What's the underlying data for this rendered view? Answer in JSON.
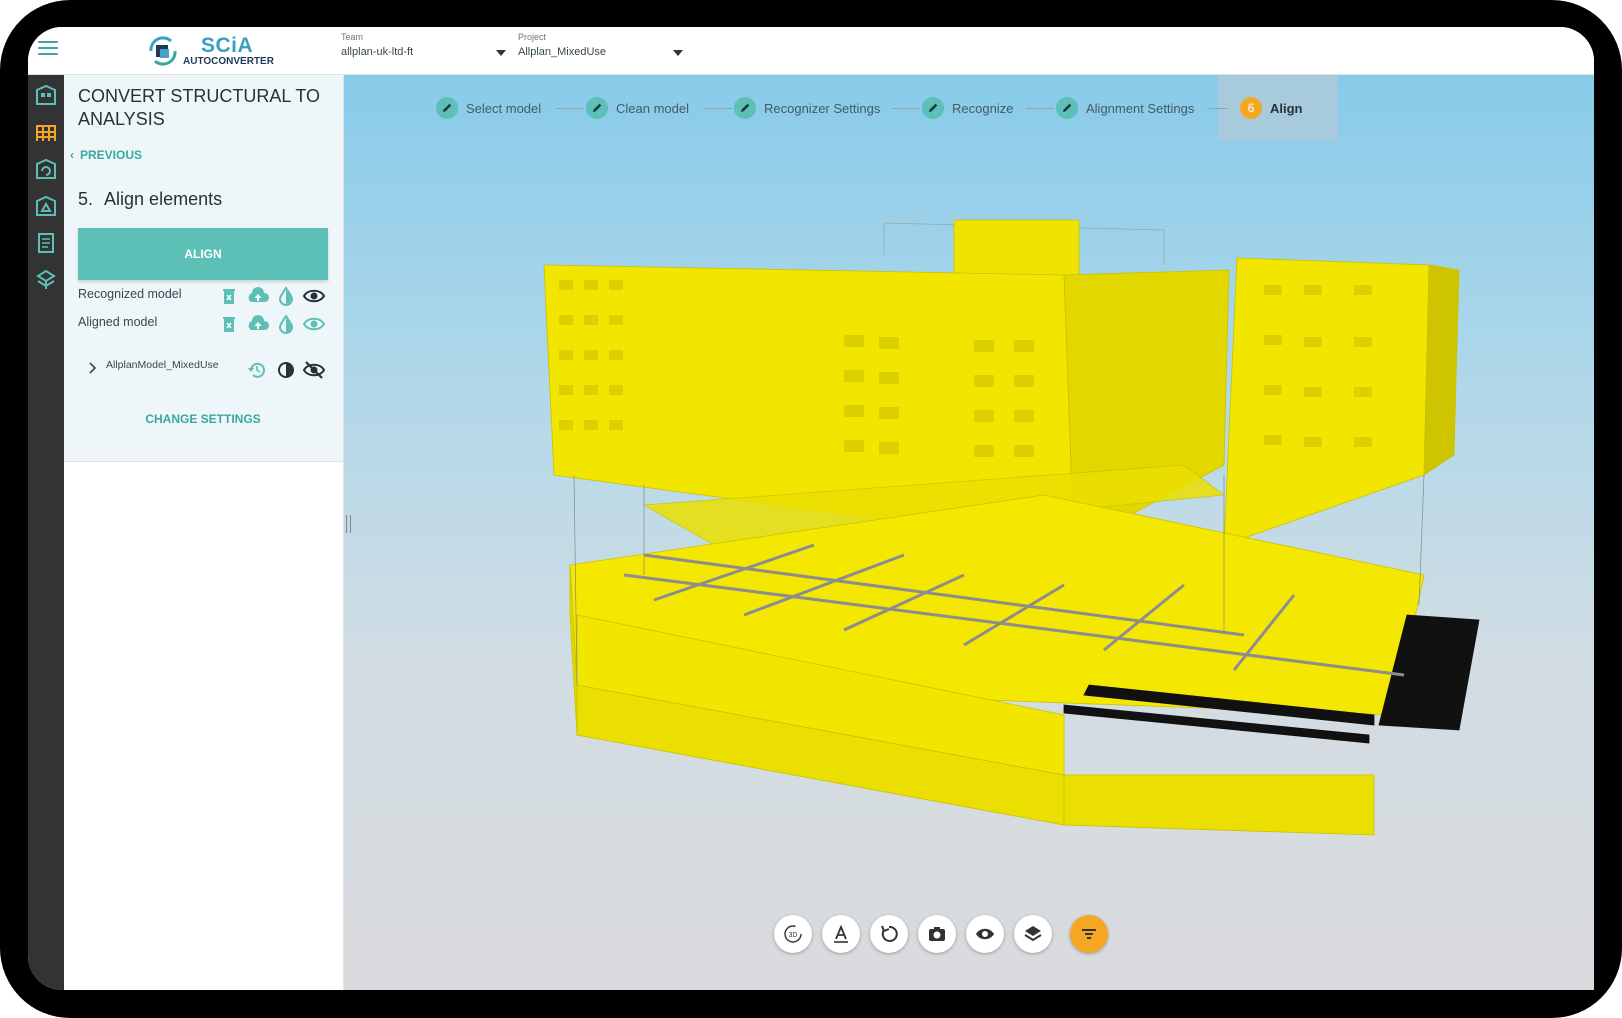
{
  "app": {
    "logo_text": "SCiA",
    "logo_sub": "AUTOCONVERTER"
  },
  "header": {
    "team_label": "Team",
    "team_value": "allplan-uk-ltd-ft",
    "project_label": "Project",
    "project_value": "Allplan_MixedUse"
  },
  "rail": {
    "icons": [
      "building-icon",
      "structure-icon",
      "convert-icon",
      "analysis-icon",
      "document-icon",
      "settings-icon"
    ]
  },
  "panel": {
    "title": "CONVERT STRUCTURAL TO ANALYSIS",
    "previous": "PREVIOUS",
    "step_number": "5.",
    "step_title": "Align elements",
    "align_button": "ALIGN",
    "recognized_model": "Recognized model",
    "aligned_model": "Aligned model",
    "tree_item": "AllplanModel_MixedUse",
    "change_settings": "CHANGE SETTINGS"
  },
  "stepper": {
    "steps": [
      {
        "label": "Select model",
        "state": "done"
      },
      {
        "label": "Clean model",
        "state": "done"
      },
      {
        "label": "Recognizer Settings",
        "state": "done"
      },
      {
        "label": "Recognize",
        "state": "done"
      },
      {
        "label": "Alignment Settings",
        "state": "done"
      },
      {
        "label": "Align",
        "state": "active",
        "number": "6"
      }
    ]
  },
  "toolbar": {
    "view_3d": "3D",
    "buttons": [
      "3d-view-icon",
      "annotation-icon",
      "reset-view-icon",
      "screenshot-icon",
      "visibility-icon",
      "layers-icon",
      "filter-icon"
    ]
  },
  "colors": {
    "accent": "#5cc0b6",
    "active_step": "#f5a623",
    "filter_button": "#f5a623",
    "model_yellow": "#f2e600",
    "rail": "#333333"
  }
}
